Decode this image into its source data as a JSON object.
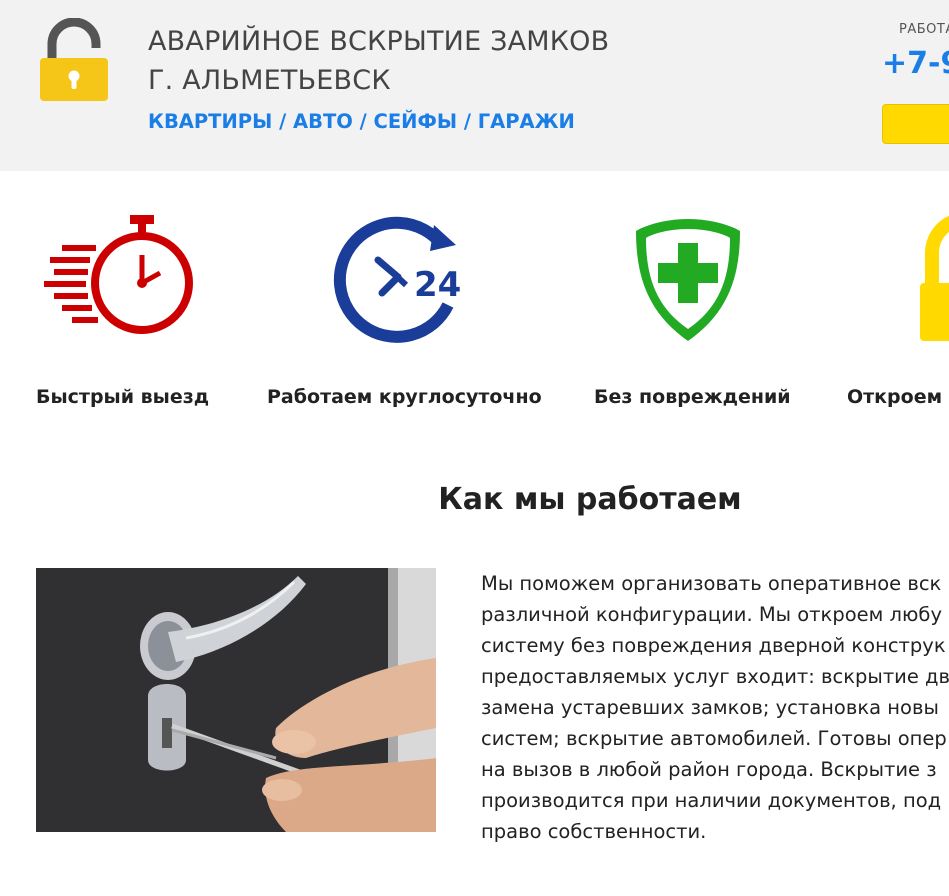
{
  "header": {
    "title_line1": "АВАРИЙНОЕ ВСКРЫТИЕ ЗАМКОВ",
    "title_line2": "Г. АЛЬМЕТЬЕВСК",
    "subtitle": "КВАРТИРЫ / АВТО / СЕЙФЫ / ГАРАЖИ",
    "work_label": "РАБОТА",
    "phone": "+7-9",
    "logo_icon": "padlock-open-icon"
  },
  "features": [
    {
      "label": "Быстрый выезд",
      "icon": "stopwatch-icon",
      "color": "#cc0000"
    },
    {
      "label": "Работаем круглосуточно",
      "icon": "clock-24-icon",
      "color": "#1a3d99"
    },
    {
      "label": "Без повреждений",
      "icon": "shield-cross-icon",
      "color": "#22aa22"
    },
    {
      "label": "Откроем л",
      "icon": "padlock-open-icon",
      "color": "#ffd900"
    }
  ],
  "section": {
    "title": "Как мы работаем"
  },
  "about": {
    "lines": [
      "Мы поможем организовать оперативное вск",
      "различной конфигурации. Мы откроем любу",
      "систему без повреждения дверной конструк",
      "предоставляемых услуг входит: вскрытие дв",
      "замена устаревших замков; установка новы",
      "систем; вскрытие автомобилей. Готовы опер",
      "на вызов в любой район города. Вскрытие з",
      "производится при наличии документов, под",
      "право собственности."
    ]
  },
  "colors": {
    "brand_blue": "#1a7ee6",
    "accent_yellow": "#ffd900",
    "header_bg": "#f2f2f2"
  }
}
